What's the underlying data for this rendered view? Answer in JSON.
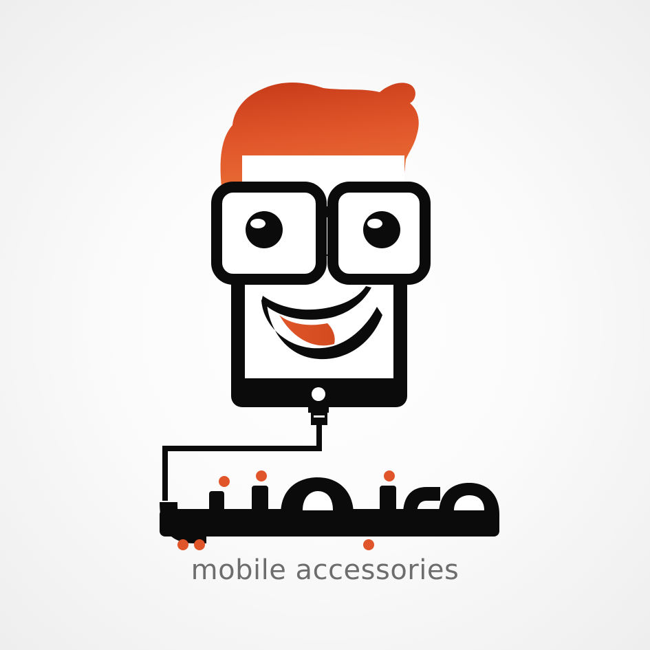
{
  "brand": {
    "name_arabic": "منجهني",
    "tagline": "mobile accessories"
  },
  "colors": {
    "accent": "#e0562a",
    "accent_dark": "#c84216",
    "ink": "#0b0b0b",
    "tagline": "#6d6d6d",
    "background": "#f7f7f7"
  },
  "icons": {
    "mascot": "phone-mascot-icon",
    "cable": "charging-cable-icon"
  }
}
